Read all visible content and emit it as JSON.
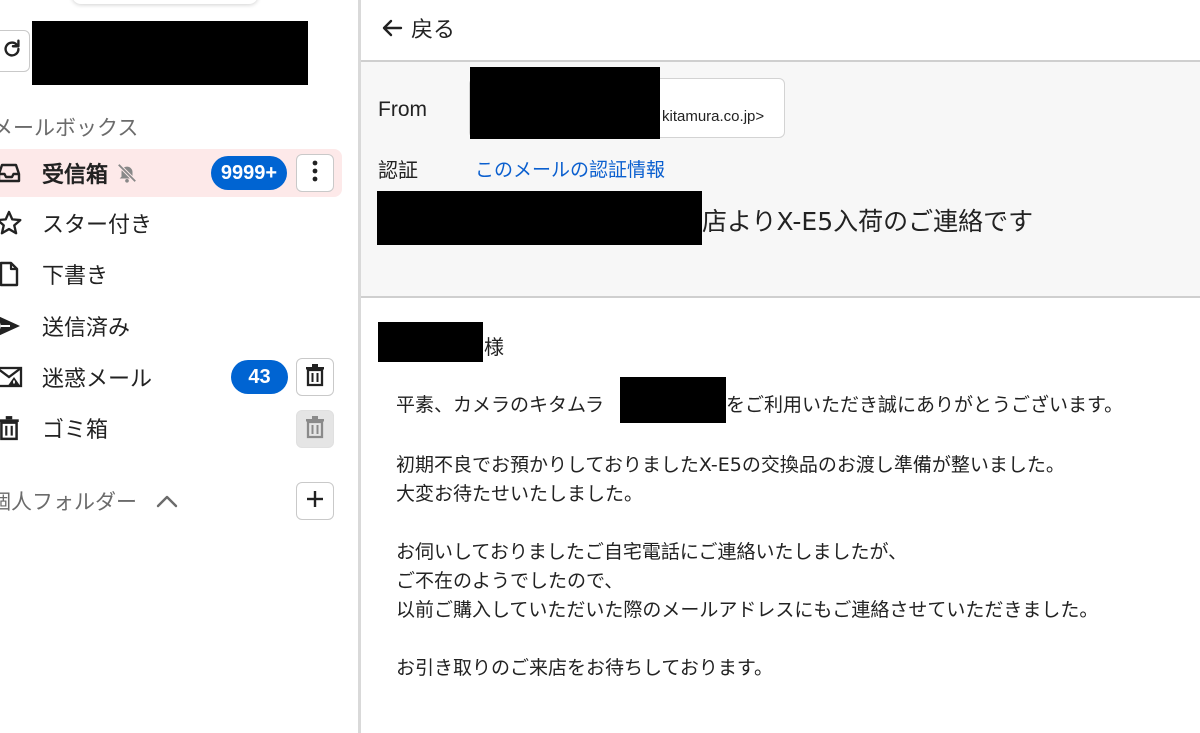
{
  "sidebar": {
    "mailbox_header": "メールボックス",
    "items": [
      {
        "label": "受信箱",
        "badge": "9999+",
        "icon": "inbox-icon"
      },
      {
        "label": "スター付き",
        "icon": "star-icon"
      },
      {
        "label": "下書き",
        "icon": "draft-icon"
      },
      {
        "label": "送信済み",
        "icon": "send-icon"
      },
      {
        "label": "迷惑メール",
        "badge": "43",
        "icon": "spam-icon"
      },
      {
        "label": "ゴミ箱",
        "icon": "trash-icon"
      }
    ],
    "folder_header": "個人フォルダー"
  },
  "main": {
    "back_label": "戻る",
    "from_label": "From",
    "from_domain": "kitamura.co.jp>",
    "auth_label": "認証",
    "auth_link": "このメールの認証情報",
    "subject": "店よりX-E5入荷のご連絡です",
    "body": {
      "salutation": "様",
      "line1": "平素、カメラのキタムラ",
      "line1_end": "をご利用いただき誠にありがとうございます。",
      "line2": "初期不良でお預かりしておりましたX-E5の交換品のお渡し準備が整いました。",
      "line3": "大変お待たせいたしました。",
      "line4": "お伺いしておりましたご自宅電話にご連絡いたしましたが、",
      "line5": "ご不在のようでしたので、",
      "line6": "以前ご購入していただいた際のメールアドレスにもご連絡させていただきました。",
      "line7": "お引き取りのご来店をお待ちしております。"
    }
  },
  "colors": {
    "accent_blue": "#0064d2",
    "link_blue": "#0a5fcf",
    "active_bg": "#fde9e9"
  }
}
